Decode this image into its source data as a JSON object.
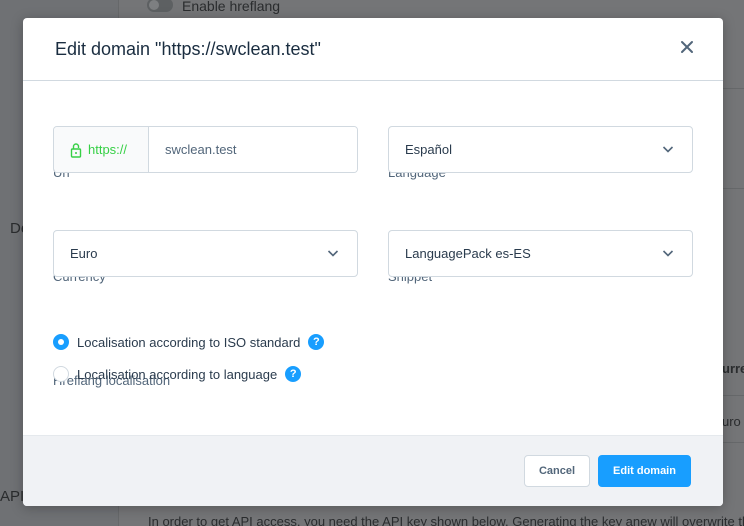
{
  "background": {
    "toggle_label": "Enable hreflang",
    "side_label_1": "De",
    "side_label_2": "API",
    "col_header": "urre",
    "col_value": "uro",
    "bottom_text": "In order to get API access, you need the API key shown below. Generating the key anew will overwrite the"
  },
  "modal": {
    "title": "Edit domain \"https://swclean.test\"",
    "close_icon": "close-icon",
    "fields": {
      "url": {
        "label": "Url",
        "prefix": "https://",
        "value": "swclean.test"
      },
      "language": {
        "label": "Language",
        "required_mark": "*",
        "value": "Español"
      },
      "currency": {
        "label": "Currency",
        "required_mark": "*",
        "value": "Euro"
      },
      "snippet": {
        "label": "Snippet",
        "required_mark": "*",
        "value": "LanguagePack es-ES"
      }
    },
    "hreflang": {
      "label": "Hreflang localisation",
      "options": [
        {
          "label": "Localisation according to ISO standard",
          "checked": true
        },
        {
          "label": "Localisation according to language",
          "checked": false
        }
      ],
      "help_glyph": "?"
    },
    "footer": {
      "cancel_label": "Cancel",
      "submit_label": "Edit domain"
    }
  },
  "colors": {
    "accent": "#189eff",
    "url_prefix": "#37d046",
    "text": "#52667a"
  }
}
